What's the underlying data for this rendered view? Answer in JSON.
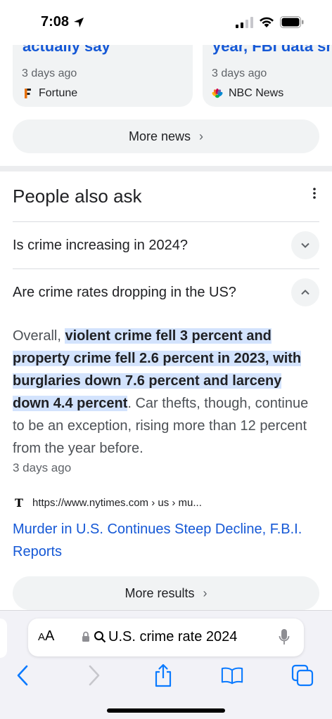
{
  "status_bar": {
    "time": "7:08"
  },
  "news_cards": [
    {
      "title": "actually say",
      "age": "3 days ago",
      "source": "Fortune"
    },
    {
      "title": "year, FBI data sho",
      "age": "3 days ago",
      "source": "NBC News"
    }
  ],
  "more_news": {
    "label": "More news",
    "chevron": "›"
  },
  "people_also_ask": {
    "title": "People also ask",
    "questions": [
      {
        "text": "Is crime increasing in 2024?",
        "expanded": false
      },
      {
        "text": "Are crime rates dropping in the US?",
        "expanded": true
      }
    ],
    "answer": {
      "prefix": "Overall, ",
      "highlight": "violent crime fell 3 percent and property crime fell 2.6 percent in 2023, with burglaries down 7.6 percent and larceny down 4.4 percent",
      "suffix": ". Car thefts, though, continue to be an exception, rising more than 12 percent from the year before.",
      "age": "3 days ago"
    },
    "source": {
      "url": "https://www.nytimes.com › us › mu...",
      "link_title": "Murder in U.S. Continues Steep Decline, F.B.I. Reports"
    }
  },
  "more_results": {
    "label": "More results",
    "chevron": "›"
  },
  "safari": {
    "aa_big": "A",
    "aa_small": "A",
    "address": "U.S. crime rate 2024"
  },
  "colors": {
    "link": "#1558d6",
    "highlight": "#d3e3fd",
    "ios_blue": "#0a7aff"
  }
}
